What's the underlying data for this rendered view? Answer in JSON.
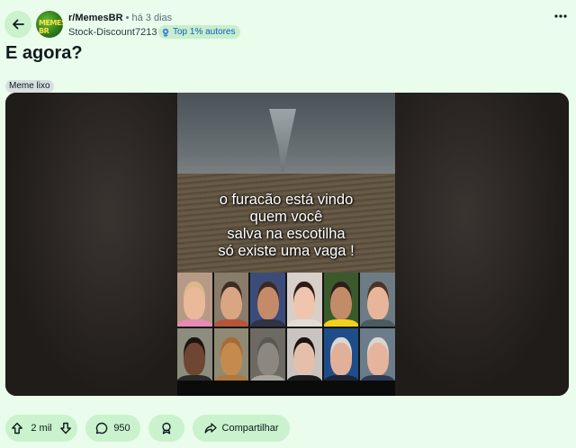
{
  "post": {
    "subreddit": "r/MemesBR",
    "time_separator": "•",
    "time_ago": "há 3 dias",
    "author": "Stock-Discount7213",
    "author_badge": "Top 1% autores",
    "title": "E agora?",
    "flair": "Meme lixo",
    "avatar_text": "MEMES BR"
  },
  "media": {
    "caption_lines": [
      "o furacão está vindo",
      "quem você",
      "salva na escotilha",
      "só existe uma vaga !"
    ],
    "faces": [
      {
        "skin": "#e9b99a",
        "hair": "#d9b98a",
        "bg": "#b79a86",
        "shirt": "#e58bb4"
      },
      {
        "skin": "#d9a683",
        "hair": "#3b2d24",
        "bg": "#8a7c6a",
        "shirt": "#b5563b"
      },
      {
        "skin": "#c48a6a",
        "hair": "#3a2a22",
        "bg": "#3b4c7a",
        "shirt": "#2f3342"
      },
      {
        "skin": "#efc5ad",
        "hair": "#2b1c16",
        "bg": "#d8cfc9",
        "shirt": "#e3dcd6"
      },
      {
        "skin": "#c38c68",
        "hair": "#2b1f1a",
        "bg": "#3a5a2c",
        "shirt": "#f3d11a"
      },
      {
        "skin": "#e6b59a",
        "hair": "#4a3426",
        "bg": "#6d7c84",
        "shirt": "#4a5b64"
      },
      {
        "skin": "#6e4631",
        "hair": "#1d1410",
        "bg": "#8c8d7e",
        "shirt": "#2a2a2a"
      },
      {
        "skin": "#c58b4e",
        "hair": "#a66a35",
        "bg": "#8f8a74",
        "shirt": "#b07840"
      },
      {
        "skin": "#8c8880",
        "hair": "#5a5650",
        "bg": "#6c6a62",
        "shirt": "#a9a59c"
      },
      {
        "skin": "#e4c0ac",
        "hair": "#1a1412",
        "bg": "#c9c4c1",
        "shirt": "#1c1c1c"
      },
      {
        "skin": "#e2b098",
        "hair": "#d9d7d2",
        "bg": "#1f4c8a",
        "shirt": "#1c2535"
      },
      {
        "skin": "#e6b39d",
        "hair": "#d8d6d2",
        "bg": "#6b7c8a",
        "shirt": "#2e3a55"
      }
    ]
  },
  "actions": {
    "upvote_count": "2 mil",
    "comment_count": "950",
    "share_label": "Compartilhar"
  },
  "colors": {
    "background": "#eafcec",
    "pill": "#c9f2cd",
    "badge_text": "#115bca"
  },
  "icons": {
    "back": "arrow-left-icon",
    "more": "more-dots-icon",
    "upvote": "arrow-up-icon",
    "downvote": "arrow-down-icon",
    "comment": "comment-bubble-icon",
    "award": "award-icon",
    "share": "share-arrow-icon",
    "badge": "trophy-icon"
  }
}
